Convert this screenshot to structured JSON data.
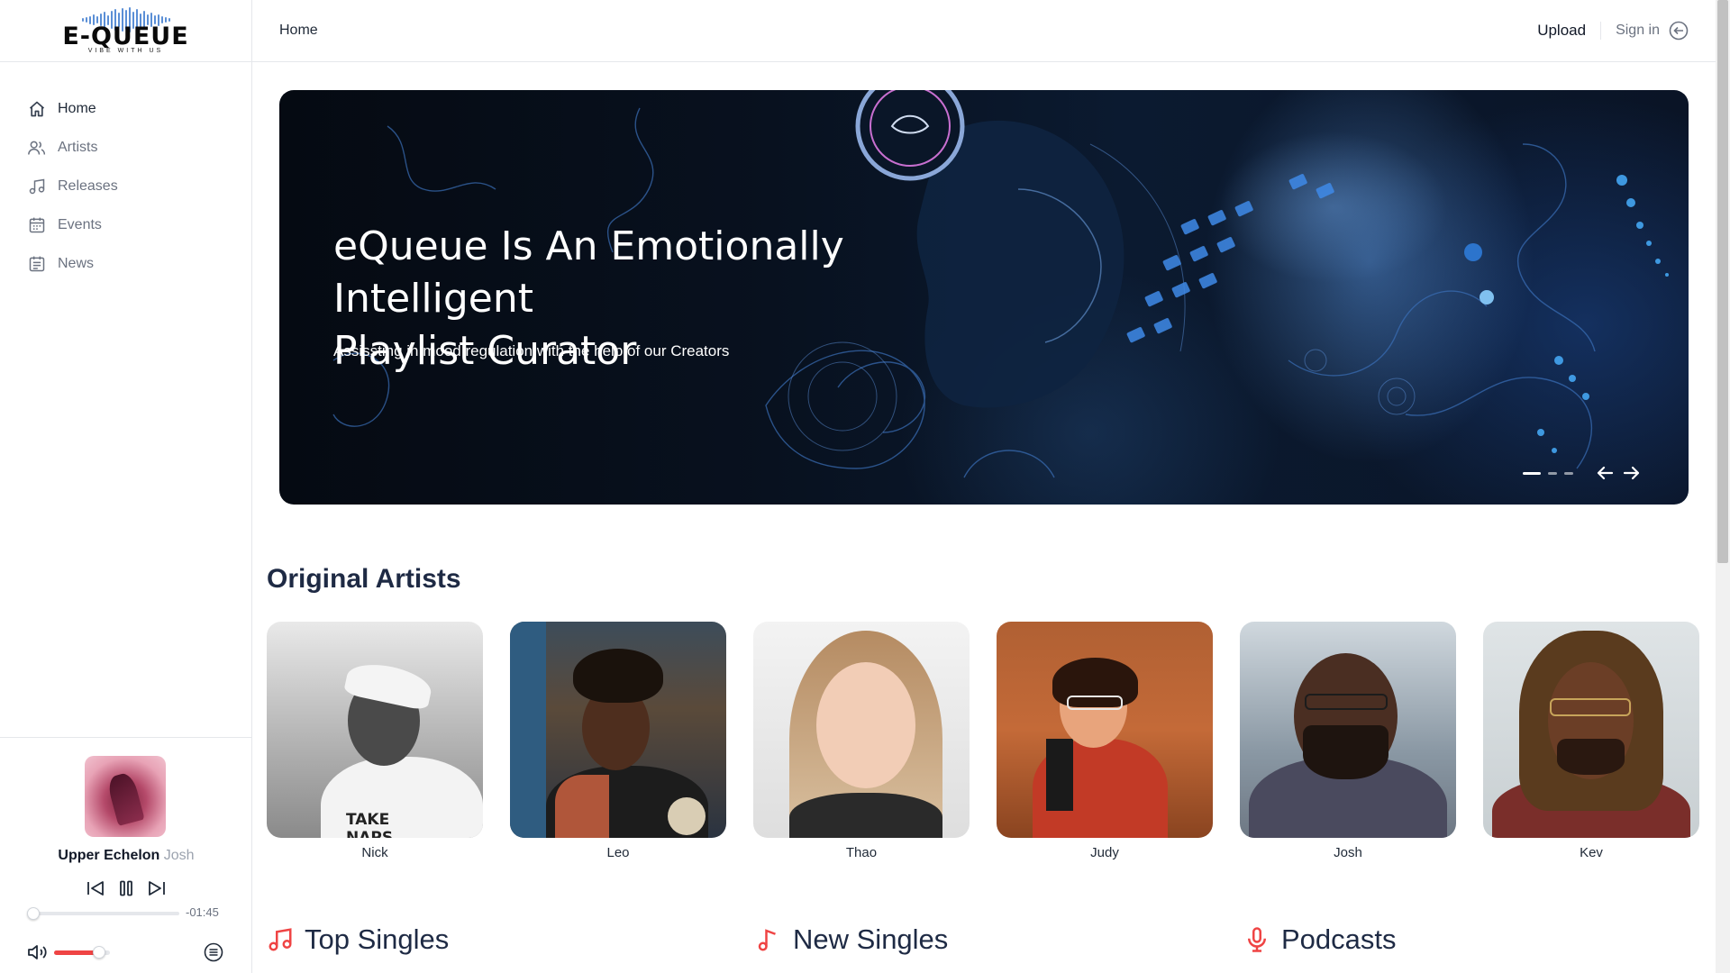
{
  "app": {
    "logo_text": "E-QUEUE",
    "logo_tagline": "VIBE WITH US"
  },
  "sidebar": {
    "items": [
      {
        "label": "Home",
        "icon": "home-icon",
        "active": true
      },
      {
        "label": "Artists",
        "icon": "users-icon",
        "active": false
      },
      {
        "label": "Releases",
        "icon": "music-note-icon",
        "active": false
      },
      {
        "label": "Events",
        "icon": "calendar-icon",
        "active": false
      },
      {
        "label": "News",
        "icon": "newspaper-icon",
        "active": false
      }
    ]
  },
  "player": {
    "title": "Upper Echelon",
    "artist": "Josh",
    "time_remaining": "-01:45",
    "progress_fraction": 0.03,
    "volume_fraction": 0.8
  },
  "header": {
    "breadcrumb": "Home",
    "upload_label": "Upload",
    "signin_label": "Sign in"
  },
  "hero": {
    "title_line1": "eQueue Is An Emotionally Intelligent",
    "title_line2": "Playlist Curator",
    "subtitle": "Assissting in mood regulation with the help of our Creators",
    "slide_count": 3,
    "active_slide": 0
  },
  "artists_section": {
    "title": "Original Artists",
    "artists": [
      {
        "name": "Nick"
      },
      {
        "name": "Leo"
      },
      {
        "name": "Thao"
      },
      {
        "name": "Judy"
      },
      {
        "name": "Josh"
      },
      {
        "name": "Kev"
      }
    ]
  },
  "categories": {
    "top_singles": "Top Singles",
    "new_singles": "New Singles",
    "podcasts": "Podcasts"
  },
  "colors": {
    "accent": "#ef4444",
    "heading": "#1e2a44",
    "muted": "#6b7280"
  }
}
